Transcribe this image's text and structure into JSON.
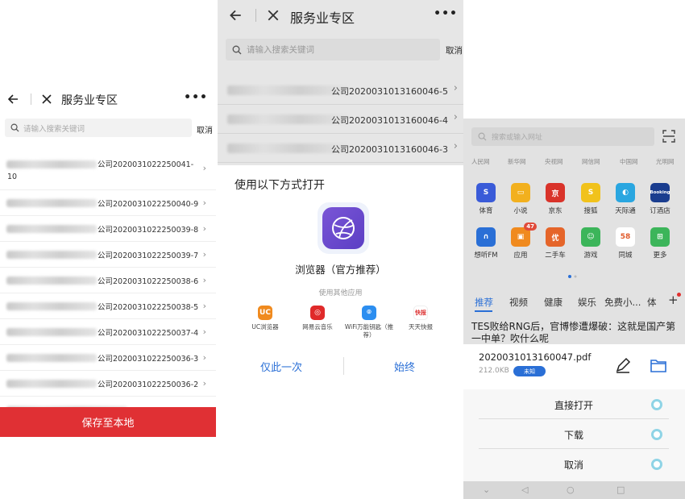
{
  "panel1": {
    "title": "服务业专区",
    "search_placeholder": "请输入搜索关键词",
    "cancel": "取消",
    "rows": [
      {
        "text": "公司2020031022250041-",
        "text2": "10"
      },
      {
        "text": "公司2020031022250040-9"
      },
      {
        "text": "公司2020031022250039-8"
      },
      {
        "text": "公司2020031022250039-7"
      },
      {
        "text": "公司2020031022250038-6"
      },
      {
        "text": "公司2020031022250038-5"
      },
      {
        "text": "公司2020031022250037-4"
      },
      {
        "text": "公司2020031022250036-3"
      },
      {
        "text": "公司2020031022250036-2"
      }
    ],
    "save_button": "保存至本地"
  },
  "panel2": {
    "title": "服务业专区",
    "search_placeholder": "请输入搜索关键词",
    "cancel": "取消",
    "rows": [
      {
        "text": "公司2020031013160046-5"
      },
      {
        "text": "公司2020031013160046-4"
      },
      {
        "text": "公司2020031013160046-3"
      }
    ],
    "sheet_title": "使用以下方式打开",
    "browser_label": "浏览器（官方推荐）",
    "other_apps_label": "使用其他应用",
    "apps": [
      {
        "label": "UC浏览器",
        "icon": "uc-browser-icon",
        "color": "#f08a1e",
        "glyph": "UC"
      },
      {
        "label": "网易云音乐",
        "icon": "netease-music-icon",
        "color": "#e02a2a",
        "glyph": "◎"
      },
      {
        "label": "WiFi万能钥匙（推荐）",
        "icon": "wifi-key-icon",
        "color": "#2c8ef0",
        "glyph": "⌾"
      },
      {
        "label": "天天快报",
        "icon": "kuaibao-icon",
        "color": "#ffffff",
        "glyph": "快报"
      }
    ],
    "once_button": "仅此一次",
    "always_button": "始终"
  },
  "panel3": {
    "search_placeholder": "搜索或输入网址",
    "sites": [
      "人民网",
      "新华网",
      "央视网",
      "网信网",
      "中国网",
      "光明网"
    ],
    "tiles": [
      {
        "label": "体育",
        "icon": "sports-icon",
        "color": "#3a5bd8",
        "glyph": "S"
      },
      {
        "label": "小说",
        "icon": "novel-icon",
        "color": "#f2b01e",
        "glyph": "▭"
      },
      {
        "label": "京东",
        "icon": "jd-icon",
        "color": "#d9332a",
        "glyph": "京"
      },
      {
        "label": "搜狐",
        "icon": "sohu-icon",
        "color": "#f1c21b",
        "glyph": "S"
      },
      {
        "label": "天际通",
        "icon": "tianjitong-icon",
        "color": "#2aa6e0",
        "glyph": "◐"
      },
      {
        "label": "订酒店",
        "icon": "booking-icon",
        "color": "#1a3d8f",
        "glyph": "Booking"
      },
      {
        "label": "想听FM",
        "icon": "fm-icon",
        "color": "#2a6fd6",
        "glyph": "∩"
      },
      {
        "label": "应用",
        "icon": "apps-icon",
        "color": "#f08a1e",
        "glyph": "▣",
        "badge": "47"
      },
      {
        "label": "二手车",
        "icon": "used-car-icon",
        "color": "#e5652a",
        "glyph": "优"
      },
      {
        "label": "游戏",
        "icon": "games-icon",
        "color": "#3cb55a",
        "glyph": "☺"
      },
      {
        "label": "同城",
        "icon": "city-icon",
        "color": "#ffffff",
        "glyph": "58"
      },
      {
        "label": "更多",
        "icon": "more-grid-icon",
        "color": "#3cb55a",
        "glyph": "⊞"
      }
    ],
    "categories": [
      "推荐",
      "视频",
      "健康",
      "娱乐",
      "免费小...",
      "体"
    ],
    "news_headline": "TES败给RNG后，官博惨遭爆破：这就是国产第一中单？吹什么呢",
    "file": {
      "name": "2020031013160047.pdf",
      "size": "212.0KB",
      "status": "未知"
    },
    "actions": [
      "直接打开",
      "下载",
      "取消"
    ]
  }
}
